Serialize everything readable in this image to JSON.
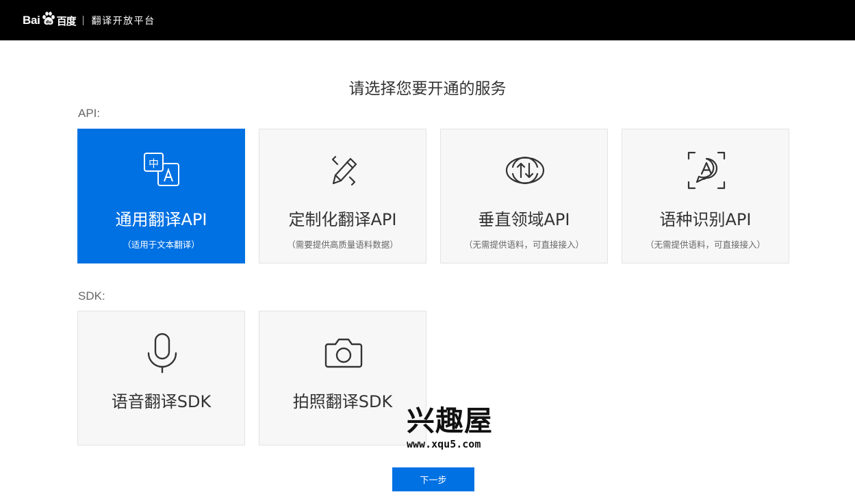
{
  "header": {
    "logo_text_bai": "Bai",
    "logo_text_baidu": "百度",
    "logo_separator": "|",
    "platform_name": "翻译开放平台",
    "paw_icon": "baidu-paw-icon",
    "background_color": "#000000"
  },
  "main": {
    "title": "请选择您要开通的服务",
    "api_section_label": "API:",
    "sdk_section_label": "SDK:",
    "api_cards": [
      {
        "title": "通用翻译API",
        "subtitle": "（适用于文本翻译）",
        "icon": "translate-zh-a-icon",
        "selected": true
      },
      {
        "title": "定制化翻译API",
        "subtitle": "（需要提供高质量语料数据）",
        "icon": "pencil-icon",
        "selected": false
      },
      {
        "title": "垂直领域API",
        "subtitle": "（无需提供语料，可直接接入）",
        "icon": "sync-arrows-icon",
        "selected": false
      },
      {
        "title": "语种识别API",
        "subtitle": "（无需提供语料，可直接接入）",
        "icon": "language-detect-icon",
        "selected": false
      }
    ],
    "sdk_cards": [
      {
        "title": "语音翻译SDK",
        "icon": "microphone-icon"
      },
      {
        "title": "拍照翻译SDK",
        "icon": "camera-icon"
      }
    ],
    "next_button_label": "下一步"
  },
  "watermark": {
    "title": "兴趣屋",
    "url": "www.xqu5.com"
  },
  "colors": {
    "accent": "#0071e3",
    "card_background": "#f7f7f7",
    "card_border": "#e3e3e3",
    "text": "#333333",
    "muted_text": "#666666"
  }
}
